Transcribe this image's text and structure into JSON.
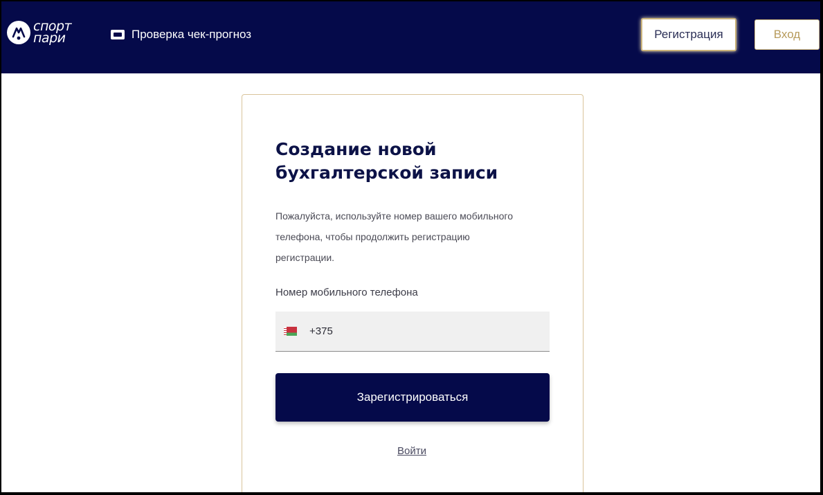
{
  "header": {
    "logo_line1": "спорт",
    "logo_line2": "пари",
    "check_link": "Проверка чек-прогноз",
    "register_button": "Регистрация",
    "login_button": "Вход"
  },
  "form": {
    "title": "Создание новой бухгалтерской записи",
    "description": "Пожалуйста, используйте номер вашего мобильного телефона, чтобы продолжить регистрацию регистрации.",
    "phone_label": "Номер мобильного телефона",
    "phone_value": "+375",
    "submit_button": "Зарегистрироваться",
    "login_link": "Войти"
  },
  "colors": {
    "header_bg": "#050a4a",
    "accent_gold": "#c9b27a",
    "title": "#0c1247"
  },
  "icons": {
    "logo": "spot-logo-icon",
    "ticket": "ticket-icon",
    "flag": "belarus-flag-icon"
  }
}
